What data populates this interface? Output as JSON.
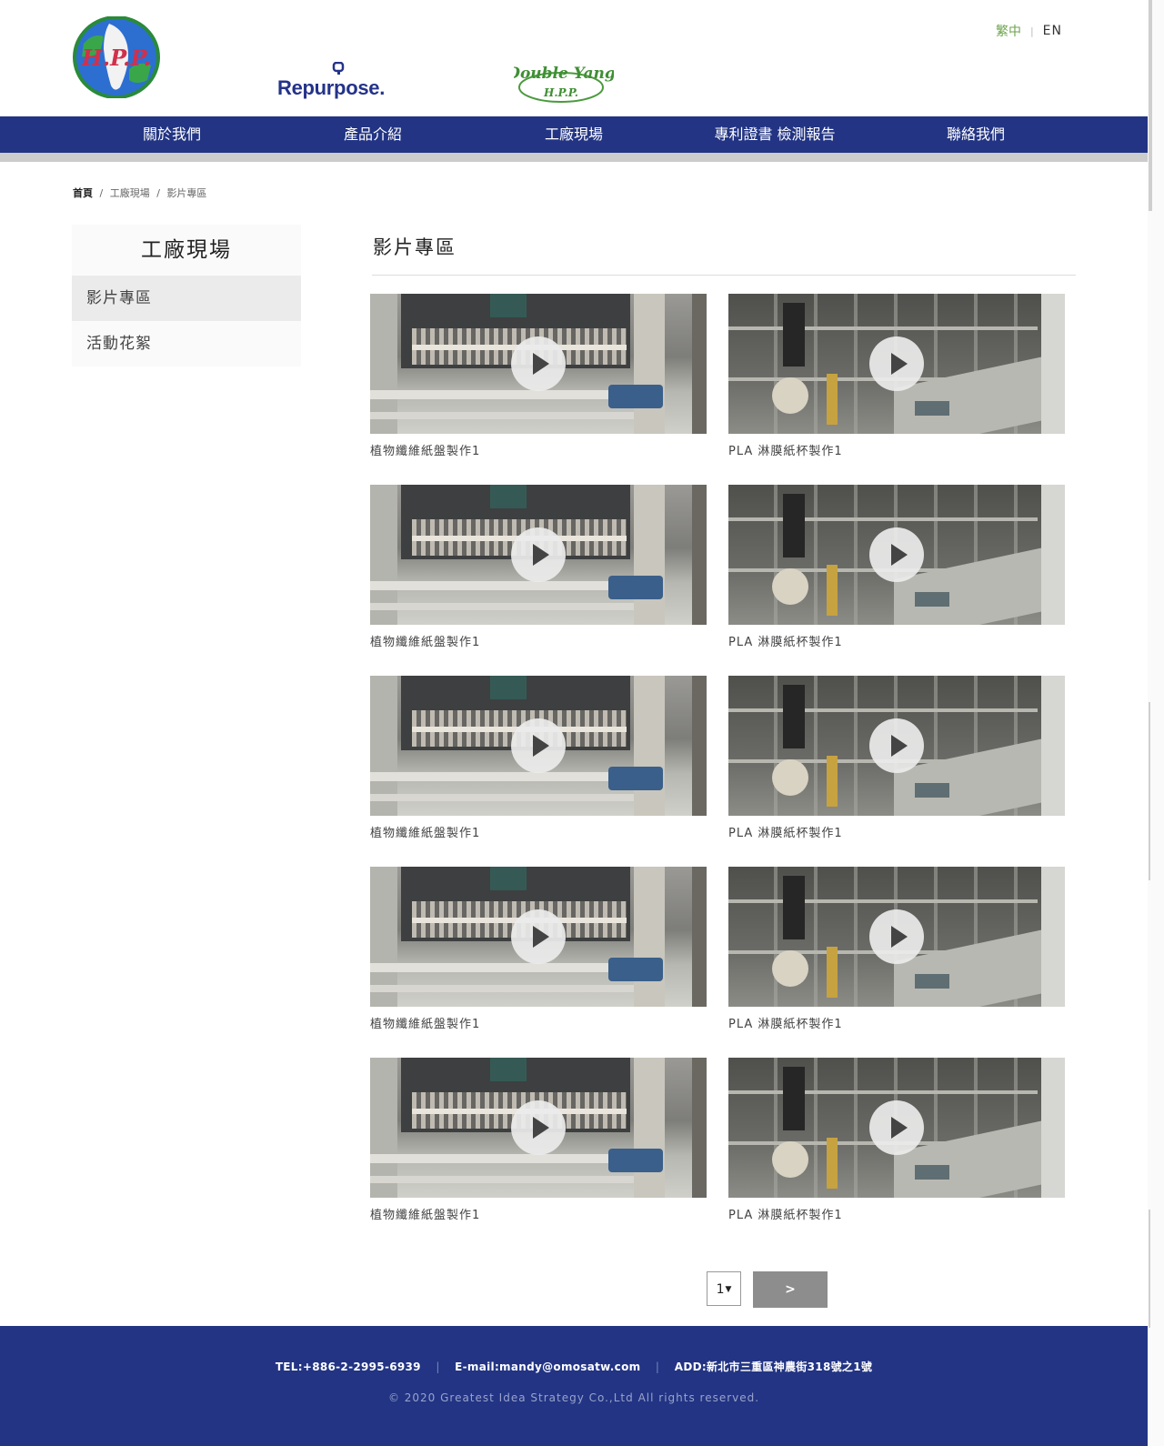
{
  "header": {
    "logos": {
      "hpp_text": "H.P.P.",
      "repurpose_text": "Repurpose.",
      "double_yang_text": "Double Yang",
      "double_yang_sub": "H.P.P."
    },
    "lang": {
      "zh": "繁中",
      "separator": "|",
      "en": "EN"
    }
  },
  "nav": {
    "items": [
      {
        "label": "關於我們"
      },
      {
        "label": "產品介紹"
      },
      {
        "label": "工廠現場"
      },
      {
        "label": "專利證書 檢測報告"
      },
      {
        "label": "聯絡我們"
      }
    ]
  },
  "breadcrumb": {
    "home": "首頁",
    "sep": "/",
    "level1": "工廠現場",
    "level2": "影片專區"
  },
  "sidebar": {
    "title": "工廠現場",
    "items": [
      {
        "label": "影片專區",
        "active": true
      },
      {
        "label": "活動花絮",
        "active": false
      }
    ]
  },
  "main": {
    "title": "影片專區",
    "videos": [
      {
        "caption": "植物纖維紙盤製作1",
        "thumb": "paper-tray-machine"
      },
      {
        "caption": "PLA 淋膜紙杯製作1",
        "thumb": "cup-machine"
      },
      {
        "caption": "植物纖維紙盤製作1",
        "thumb": "paper-tray-machine"
      },
      {
        "caption": "PLA 淋膜紙杯製作1",
        "thumb": "cup-machine"
      },
      {
        "caption": "植物纖維紙盤製作1",
        "thumb": "paper-tray-machine"
      },
      {
        "caption": "PLA 淋膜紙杯製作1",
        "thumb": "cup-machine"
      },
      {
        "caption": "植物纖維紙盤製作1",
        "thumb": "paper-tray-machine"
      },
      {
        "caption": "PLA 淋膜紙杯製作1",
        "thumb": "cup-machine"
      },
      {
        "caption": "植物纖維紙盤製作1",
        "thumb": "paper-tray-machine"
      },
      {
        "caption": "PLA 淋膜紙杯製作1",
        "thumb": "cup-machine"
      }
    ]
  },
  "pagination": {
    "current_page": "1",
    "next_label": ">"
  },
  "footer": {
    "tel": "TEL:+886-2-2995-6939",
    "email": "E-mail:mandy@omosatw.com",
    "address": "ADD:新北市三重區神農街318號之1號",
    "separator": "|",
    "copyright": "© 2020 Greatest Idea Strategy Co.,Ltd All rights reserved."
  },
  "colors": {
    "nav_bg": "#223483",
    "footer_bg": "#223483",
    "lang_active": "#6da34d",
    "pager_next_bg": "#8d8d8d"
  },
  "icons": {
    "play": "play-icon",
    "dropdown": "caret-down-icon"
  }
}
